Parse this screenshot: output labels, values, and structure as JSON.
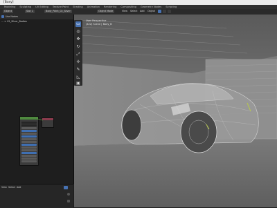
{
  "window": {
    "title": "[Boxy]"
  },
  "menu": [
    "Modeling",
    "Sculpting",
    "UV Editing",
    "Texture Paint",
    "Shading",
    "Animation",
    "Rendering",
    "Compositing",
    "Geometry Nodes",
    "Scripting"
  ],
  "header": {
    "left_items": [
      "Object",
      "Slot 1",
      "Body_Paint_02_Silver"
    ],
    "viewport_mode": "Object Mode",
    "viewport_menus": [
      "View",
      "Select",
      "Add",
      "Object"
    ]
  },
  "node_editor": {
    "header_items": [
      "Use Nodes"
    ],
    "breadcrumb": "... > 02_Silver_Bodies"
  },
  "viewport": {
    "view_name": "User Perspective",
    "collection": "(422) Scene | Body_B"
  },
  "left_bottom": {
    "items": [
      "View",
      "Select",
      "Add"
    ]
  },
  "accent": "#4772b3",
  "node_header_color": "#4f8a3f"
}
